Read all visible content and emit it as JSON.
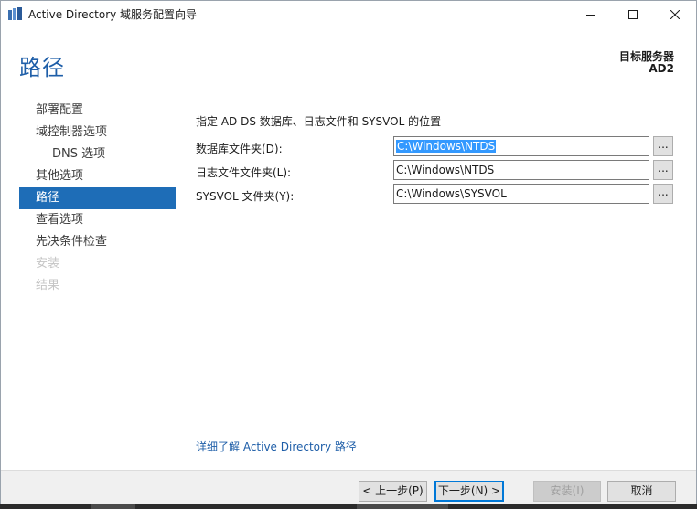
{
  "window": {
    "title": "Active Directory 域服务配置向导",
    "minimize_icon": "minimize-icon",
    "maximize_icon": "maximize-icon",
    "close_icon": "close-icon"
  },
  "header": {
    "page_title": "路径",
    "target_label": "目标服务器",
    "target_name": "AD2"
  },
  "nav": {
    "items": [
      {
        "label": "部署配置",
        "state": "normal"
      },
      {
        "label": "域控制器选项",
        "state": "normal"
      },
      {
        "label": "DNS 选项",
        "state": "normal"
      },
      {
        "label": "其他选项",
        "state": "normal"
      },
      {
        "label": "路径",
        "state": "active"
      },
      {
        "label": "查看选项",
        "state": "normal"
      },
      {
        "label": "先决条件检查",
        "state": "normal"
      },
      {
        "label": "安装",
        "state": "disabled"
      },
      {
        "label": "结果",
        "state": "disabled"
      }
    ]
  },
  "content": {
    "instruction": "指定 AD DS 数据库、日志文件和 SYSVOL 的位置",
    "rows": [
      {
        "label": "数据库文件夹(D):",
        "value": "C:\\Windows\\NTDS",
        "browse": "..."
      },
      {
        "label": "日志文件文件夹(L):",
        "value": "C:\\Windows\\NTDS",
        "browse": "..."
      },
      {
        "label": "SYSVOL 文件夹(Y):",
        "value": "C:\\Windows\\SYSVOL",
        "browse": "..."
      }
    ],
    "learn_more": "详细了解 Active Directory 路径"
  },
  "footer": {
    "prev": "< 上一步(P)",
    "next": "下一步(N) >",
    "install": "安装(I)",
    "cancel": "取消"
  },
  "colors": {
    "accent": "#1e6db7",
    "title_blue": "#1e5ea8",
    "selection": "#3399ff"
  }
}
